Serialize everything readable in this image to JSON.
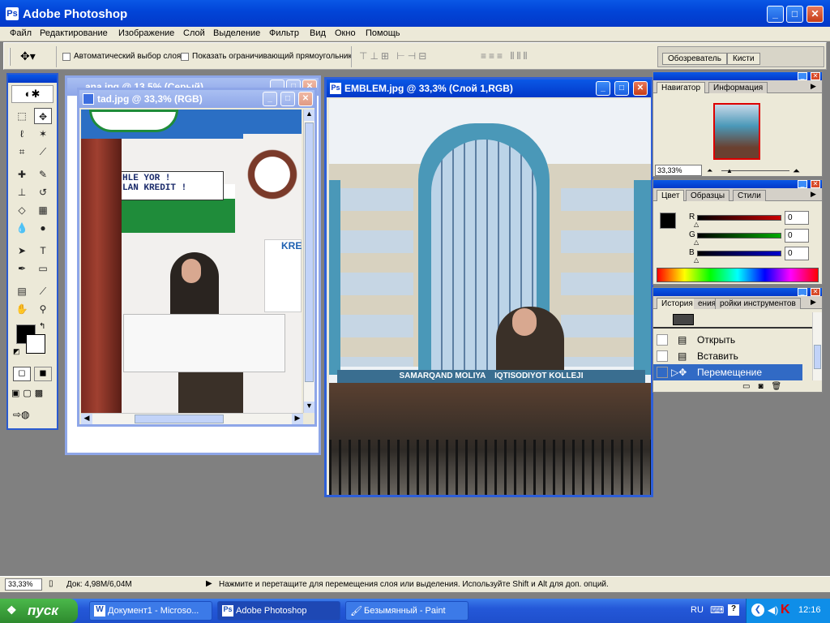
{
  "app": {
    "title": "Adobe Photoshop",
    "icon": "photoshop-icon",
    "window_buttons": {
      "minimize": "_",
      "maximize": "□",
      "close": "✕"
    }
  },
  "menu": [
    "Файл",
    "Редактирование",
    "Изображение",
    "Слой",
    "Выделение",
    "Фильтр",
    "Вид",
    "Окно",
    "Помощь"
  ],
  "options": {
    "auto_select_label": "Автоматический выбор слоя",
    "auto_select_checked": false,
    "show_bounds_label": "Показать ограничивающий прямоугольник",
    "show_bounds_checked": false,
    "well_tabs": [
      "Обозреватель",
      "Кисти"
    ]
  },
  "documents": [
    {
      "title": "ana.jpg @ 13,5% (Серый)",
      "active": false
    },
    {
      "title": "tad.jpg @ 33,3% (RGB)",
      "active": false
    },
    {
      "title": "EMBLEM.jpg @ 33,3% (Слой 1,RGB)",
      "active": true
    }
  ],
  "emblem_photo": {
    "sign_text": "SAMARQAND MOLIYA    IQTISODIYOT KOLLEJI"
  },
  "tad_photo": {
    "banner_line1": "HLE YOR !",
    "banner_line2": "LAN KREDIT !",
    "side_text": "KRE"
  },
  "navigator": {
    "tabs": [
      "Навигатор",
      "Информация"
    ],
    "zoom": "33,33%"
  },
  "color_panel": {
    "tabs": [
      "Цвет",
      "Образцы",
      "Стили"
    ],
    "channels": [
      {
        "label": "R",
        "value": "0",
        "color": "#cc0000"
      },
      {
        "label": "G",
        "value": "0",
        "color": "#00aa00"
      },
      {
        "label": "B",
        "value": "0",
        "color": "#0000cc"
      }
    ]
  },
  "history": {
    "tabs": [
      "История",
      "ения",
      "ройки инструментов"
    ],
    "items": [
      {
        "label": "Открыть",
        "selected": false
      },
      {
        "label": "Вставить",
        "selected": false
      },
      {
        "label": "Перемещение",
        "selected": true
      }
    ]
  },
  "status": {
    "zoom": "33,33%",
    "doc": "Док: 4,98М/6,04М",
    "hint": "Нажмите и перетащите для перемещения слоя или выделения. Используйте Shift и Alt для доп. опций."
  },
  "taskbar": {
    "start": "пуск",
    "buttons": [
      {
        "label": "Документ1 - Microso...",
        "active": false
      },
      {
        "label": "Adobe Photoshop",
        "active": true
      },
      {
        "label": "Безымянный - Paint",
        "active": false
      }
    ],
    "lang": "RU",
    "time": "12:16"
  }
}
